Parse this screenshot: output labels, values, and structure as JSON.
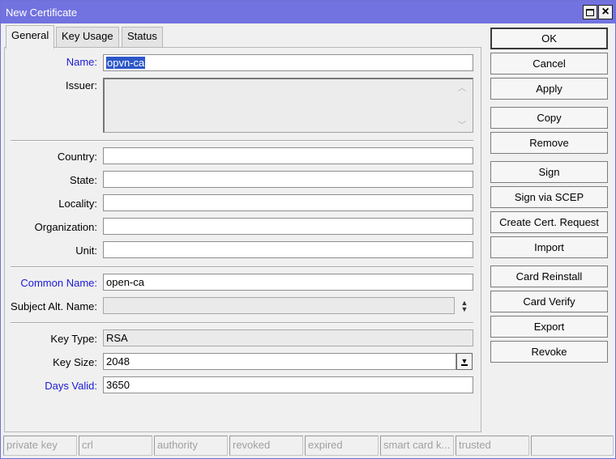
{
  "window": {
    "title": "New Certificate"
  },
  "tabs": [
    {
      "label": "General",
      "active": true
    },
    {
      "label": "Key Usage",
      "active": false
    },
    {
      "label": "Status",
      "active": false
    }
  ],
  "general": {
    "name_label": "Name:",
    "name_value": "opvn-ca",
    "issuer_label": "Issuer:",
    "issuer_value": "",
    "country_label": "Country:",
    "state_label": "State:",
    "locality_label": "Locality:",
    "organization_label": "Organization:",
    "unit_label": "Unit:",
    "common_name_label": "Common Name:",
    "common_name_value": "open-ca",
    "subject_alt_name_label": "Subject Alt. Name:",
    "key_type_label": "Key Type:",
    "key_type_value": "RSA",
    "key_size_label": "Key Size:",
    "key_size_value": "2048",
    "days_valid_label": "Days Valid:",
    "days_valid_value": "3650"
  },
  "buttons": {
    "ok": "OK",
    "cancel": "Cancel",
    "apply": "Apply",
    "copy": "Copy",
    "remove": "Remove",
    "sign": "Sign",
    "sign_via_scep": "Sign via SCEP",
    "create_cert_request": "Create Cert. Request",
    "import": "Import",
    "card_reinstall": "Card Reinstall",
    "card_verify": "Card Verify",
    "export": "Export",
    "revoke": "Revoke"
  },
  "status_bar": [
    "private key",
    "crl",
    "authority",
    "revoked",
    "expired",
    "smart card k...",
    "trusted",
    ""
  ],
  "colors": {
    "titlebar": "#7272e0",
    "label_blue": "#1a1ad6",
    "selection": "#2d57c9"
  }
}
